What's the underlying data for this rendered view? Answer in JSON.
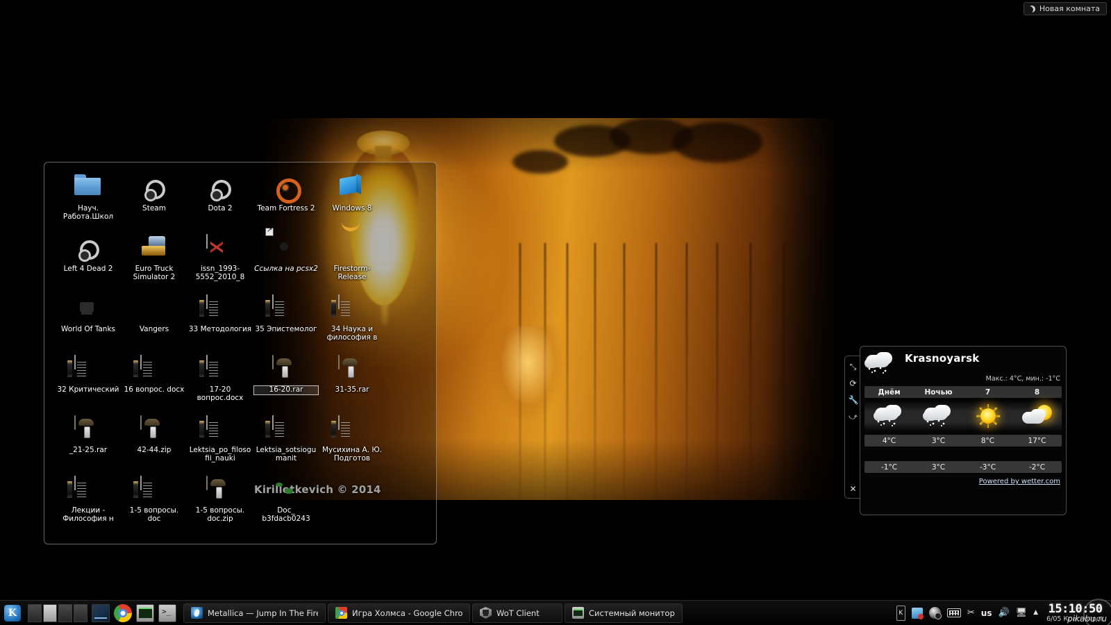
{
  "newroom": {
    "label": "Новая комната",
    "icon": "moon-icon"
  },
  "watermark": "Kirillotkevich © 2014",
  "folderview": {
    "icons": [
      {
        "label": "Науч. Работа.Школ",
        "type": "folder",
        "selected": false
      },
      {
        "label": "Steam",
        "type": "steam",
        "selected": false
      },
      {
        "label": "Dota 2",
        "type": "steam",
        "selected": false
      },
      {
        "label": "Team Fortress 2",
        "type": "tf2",
        "selected": false
      },
      {
        "label": "Windows 8",
        "type": "win8",
        "selected": false
      },
      {
        "label": "Left 4 Dead 2",
        "type": "steam",
        "selected": false
      },
      {
        "label": "Euro Truck Simulator 2",
        "type": "euro",
        "selected": false
      },
      {
        "label": "issn_1993-5552_2010_8",
        "type": "pdf",
        "selected": false
      },
      {
        "label": "Ссылка на pcsx2",
        "type": "gear-link",
        "italic": true,
        "selected": false
      },
      {
        "label": "Firestorm-Release",
        "type": "firestorm",
        "selected": false
      },
      {
        "label": "World Of Tanks",
        "type": "wot",
        "selected": false
      },
      {
        "label": "Vangers",
        "type": "vangers",
        "selected": false
      },
      {
        "label": "33 Методология",
        "type": "doc",
        "selected": false
      },
      {
        "label": "35 Эпистемолог",
        "type": "doc",
        "selected": false
      },
      {
        "label": "34 Наука и философия в",
        "type": "doc",
        "selected": false
      },
      {
        "label": "32 Критический",
        "type": "doc",
        "selected": false
      },
      {
        "label": "16 вопрос. docx",
        "type": "doc",
        "selected": false
      },
      {
        "label": "17-20 вопрос.docx",
        "type": "doc",
        "selected": false
      },
      {
        "label": "16-20.rar",
        "type": "zip",
        "selected": true
      },
      {
        "label": "31-35.rar",
        "type": "zip",
        "selected": false
      },
      {
        "label": "_21-25.rar",
        "type": "zip",
        "selected": false
      },
      {
        "label": "42-44.zip",
        "type": "zip",
        "selected": false
      },
      {
        "label": "Lektsia_po_filosofii_nauki",
        "type": "docb",
        "selected": false
      },
      {
        "label": "Lektsia_sotsiogumanit",
        "type": "docb",
        "selected": false
      },
      {
        "label": "Мусихина А. Ю. Подготов",
        "type": "docb",
        "selected": false
      },
      {
        "label": "Лекции - Философия н",
        "type": "docb",
        "selected": false
      },
      {
        "label": "1-5 вопросы. doc",
        "type": "docb",
        "selected": false
      },
      {
        "label": "1-5 вопросы. doc.zip",
        "type": "zip",
        "selected": false
      },
      {
        "label": "Doc_ b3fdacb0243",
        "type": "globe",
        "selected": false
      }
    ]
  },
  "weather": {
    "city": "Krasnoyarsk",
    "minmax": "Макс.: 4°C, мин.: -1°C",
    "current_icon": "snow-icon",
    "columns": [
      {
        "label": "Днём",
        "icon": "snow-icon",
        "high": "4°C",
        "low": "-1°C"
      },
      {
        "label": "Ночью",
        "icon": "snow-icon",
        "high": "3°C",
        "low": "3°C"
      },
      {
        "label": "7",
        "icon": "sun-icon",
        "high": "8°C",
        "low": "-3°C"
      },
      {
        "label": "8",
        "icon": "partly-icon",
        "high": "17°C",
        "low": "-2°C"
      }
    ],
    "powered_by": "Powered by wetter.com",
    "handle_buttons": [
      {
        "name": "resize-icon",
        "glyph": "⤡"
      },
      {
        "name": "refresh-icon",
        "glyph": "⟳"
      },
      {
        "name": "settings-icon",
        "glyph": "🔧"
      },
      {
        "name": "share-icon",
        "glyph": "⤻"
      },
      {
        "name": "close-icon",
        "glyph": "✕"
      }
    ]
  },
  "taskbar": {
    "kmenu_letter": "K",
    "pager": [
      {
        "name": "desktop-1",
        "active": false
      },
      {
        "name": "desktop-2",
        "active": true
      },
      {
        "name": "desktop-3",
        "active": false
      },
      {
        "name": "desktop-4",
        "active": false
      }
    ],
    "launchers": [
      {
        "name": "show-desktop-button",
        "cls": "l-showdesk"
      },
      {
        "name": "chrome-launcher",
        "cls": "l-chrome"
      },
      {
        "name": "system-monitor-launcher",
        "cls": "l-monitor"
      },
      {
        "name": "terminal-launcher",
        "cls": "l-term"
      }
    ],
    "tasks": [
      {
        "title": "Metallica — Jump In The Fire",
        "icon": "ti-amarok"
      },
      {
        "title": "Игра Холмса - Google Chrom",
        "icon": "ti-chrome"
      },
      {
        "title": "WoT Client",
        "icon": "ti-wot"
      },
      {
        "title": "Системный монитор",
        "icon": "ti-sysmon"
      }
    ],
    "tray": {
      "kmix_letter": "K",
      "language": "us",
      "volume_glyph": "🔊",
      "display_glyph": "🖥",
      "arrow_glyph": "▲",
      "scissors_glyph": "✂"
    },
    "clock": {
      "time": "15:10:50",
      "date": "6/05 Красноярск"
    }
  },
  "pikabu": "pikabu.ru"
}
